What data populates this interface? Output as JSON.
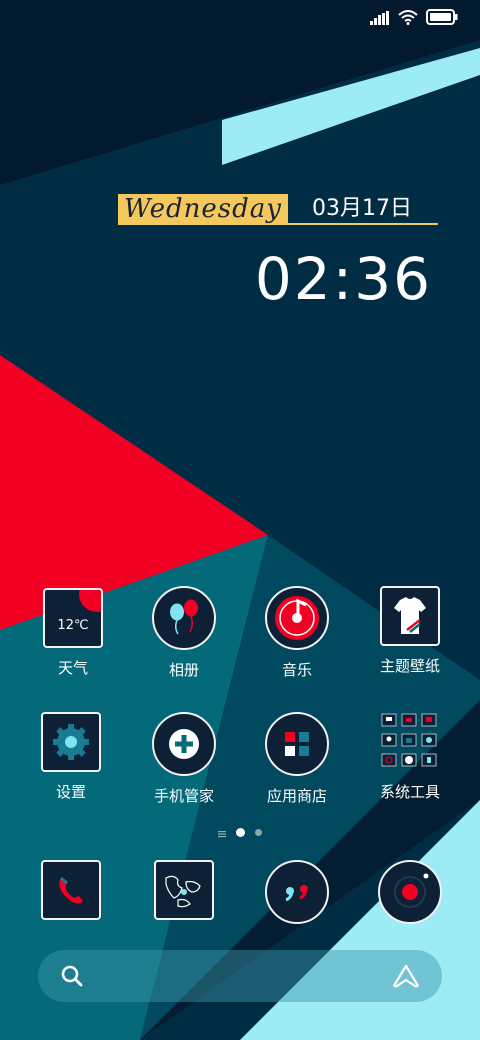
{
  "clock": {
    "day": "Wednesday",
    "date": "03月17日",
    "time": "02:36"
  },
  "status": {
    "signal_icon": "signal-icon",
    "wifi_icon": "wifi-icon",
    "battery_icon": "battery-icon"
  },
  "apps": {
    "weather": {
      "label": "天气",
      "temp": "12℃"
    },
    "gallery": {
      "label": "相册"
    },
    "music": {
      "label": "音乐"
    },
    "themes": {
      "label": "主题壁纸"
    },
    "settings": {
      "label": "设置"
    },
    "security": {
      "label": "手机管家"
    },
    "store": {
      "label": "应用商店"
    },
    "tools": {
      "label": "系统工具"
    }
  },
  "dock": [
    "phone-icon",
    "browser-map-icon",
    "messages-icon",
    "camera-icon"
  ],
  "pager": {
    "pages": 2,
    "current": 1
  },
  "colors": {
    "navy": "#012d44",
    "dark": "#031a2e",
    "red": "#f20023",
    "teal": "#046a7a",
    "cyan": "#9debf5",
    "yellow": "#f4c85c"
  }
}
